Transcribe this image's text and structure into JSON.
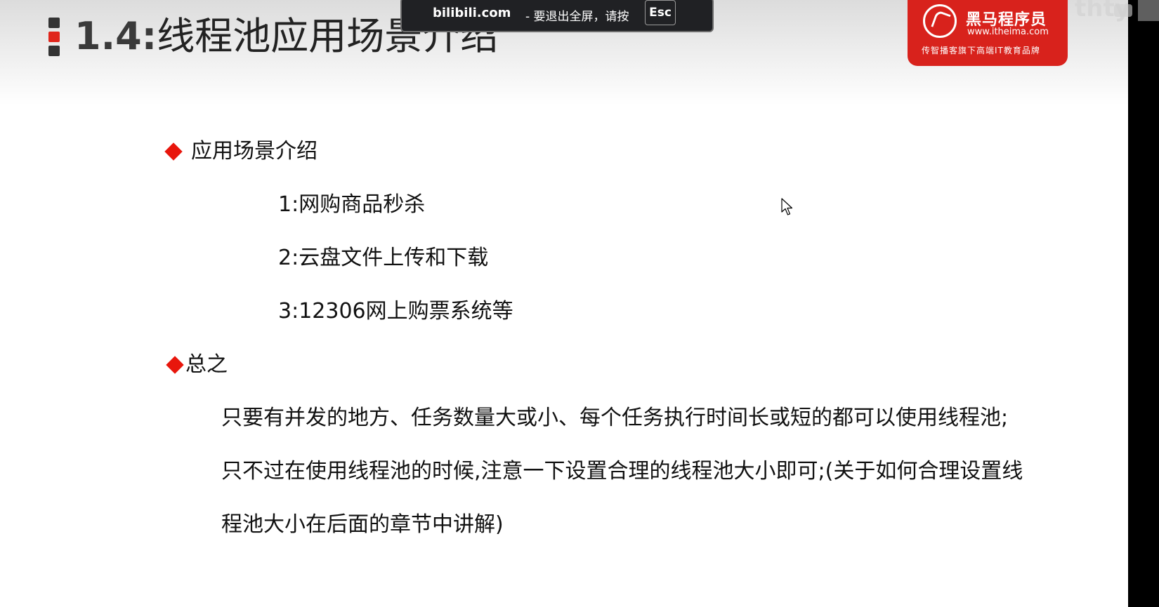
{
  "fullscreen_notice": {
    "site": "bilibili.com",
    "message": "- 要退出全屏，请按",
    "key": "Esc"
  },
  "slide": {
    "title_number": "1.4:",
    "title_text": "线程池应用场景介绍",
    "bullets": [
      {
        "heading": "应用场景介绍",
        "items": [
          "1:网购商品秒杀",
          "2:云盘文件上传和下载",
          "3:12306网上购票系统等"
        ]
      },
      {
        "heading": "总之",
        "lines": [
          "只要有并发的地方、任务数量大或小、每个任务执行时间长或短的都可以使用线程池;",
          "只不过在使用线程池的时候,注意一下设置合理的线程池大小即可;(关于如何合理设置线",
          "程池大小在后面的章节中讲解)"
        ]
      }
    ]
  },
  "logo": {
    "name": "黑马程序员",
    "url": "www.itheima.com",
    "slogan": "传智播客旗下高端IT教育品牌"
  },
  "watermark": "thty",
  "colors": {
    "accent": "#e8160c",
    "logo_bg": "#d8221c",
    "notice_bg": "#202124"
  },
  "icons": [
    "slide-title-marker-icon",
    "itheima-horse-logo-icon",
    "mouse-cursor-icon",
    "diamond-bullet-icon"
  ]
}
